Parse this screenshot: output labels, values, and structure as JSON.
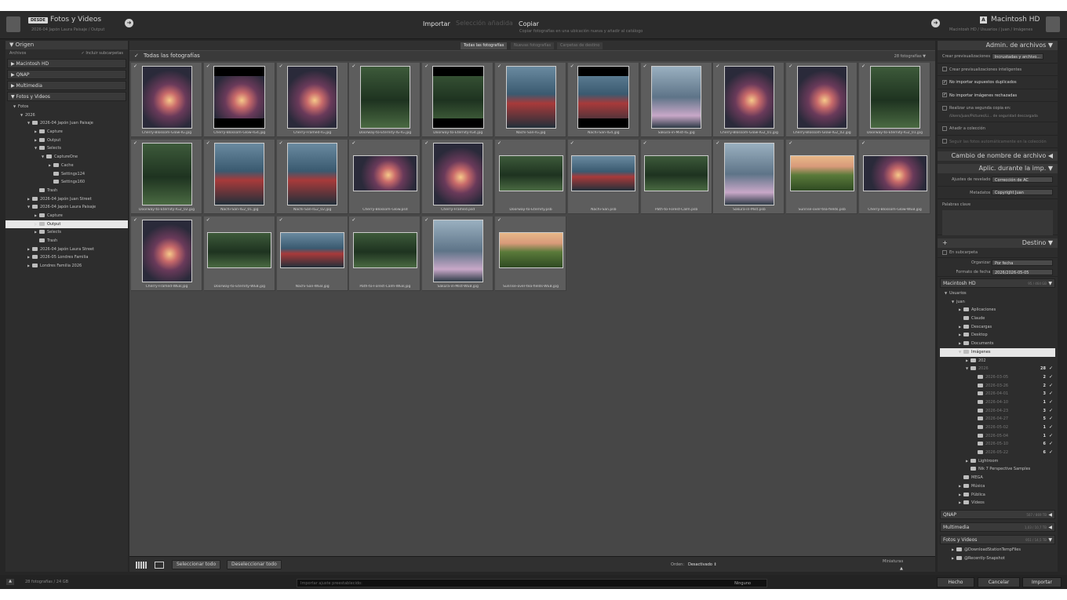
{
  "source": {
    "badge": "DESDE",
    "title": "Fotos y Videos",
    "path": "2026-04 Japón Laura Paisaje / Output",
    "tree": [
      {
        "label": "Fotos",
        "depth": 0,
        "tri": "▼",
        "folder": false
      },
      {
        "label": "2026",
        "depth": 1,
        "tri": "▼",
        "folder": false
      },
      {
        "label": "2026-04 Japón Juan Paisaje",
        "depth": 2,
        "tri": "▼",
        "folder": true
      },
      {
        "label": "Capture",
        "depth": 3,
        "tri": "▶",
        "folder": true
      },
      {
        "label": "Output",
        "depth": 3,
        "tri": "▶",
        "folder": true
      },
      {
        "label": "Selects",
        "depth": 3,
        "tri": "▼",
        "folder": true
      },
      {
        "label": "CaptureOne",
        "depth": 4,
        "tri": "▼",
        "folder": true
      },
      {
        "label": "Cache",
        "depth": 5,
        "tri": "▶",
        "folder": true
      },
      {
        "label": "Settings124",
        "depth": 5,
        "tri": "",
        "folder": true
      },
      {
        "label": "Settings160",
        "depth": 5,
        "tri": "",
        "folder": true
      },
      {
        "label": "Trash",
        "depth": 3,
        "tri": "",
        "folder": true
      },
      {
        "label": "2026-04 Japón Juan Street",
        "depth": 2,
        "tri": "▶",
        "folder": true
      },
      {
        "label": "2026-04 Japón Laura Paisaje",
        "depth": 2,
        "tri": "▼",
        "folder": true
      },
      {
        "label": "Capture",
        "depth": 3,
        "tri": "▶",
        "folder": true
      },
      {
        "label": "Output",
        "depth": 3,
        "tri": "▷",
        "folder": true,
        "selected": true
      },
      {
        "label": "Selects",
        "depth": 3,
        "tri": "▶",
        "folder": true
      },
      {
        "label": "Trash",
        "depth": 3,
        "tri": "",
        "folder": true
      },
      {
        "label": "2026-04 Japón Laura Street",
        "depth": 2,
        "tri": "▶",
        "folder": true
      },
      {
        "label": "2026-05 Londres Familia",
        "depth": 2,
        "tri": "▶",
        "folder": true
      },
      {
        "label": "Londres Familia 2026",
        "depth": 2,
        "tri": "▶",
        "folder": true
      }
    ]
  },
  "left_panel": {
    "header": "Origen",
    "archivos_label": "Archivos",
    "include_sub": "Incluir subcarpetas",
    "volumes": [
      "Macintosh HD",
      "QNAP",
      "Multimedia",
      "Fotos y Videos"
    ],
    "volume_tris": [
      "▶",
      "▶",
      "▶",
      "▼"
    ]
  },
  "modes": {
    "import": "Importar",
    "selection": "Selección añadida",
    "copy": "Copiar",
    "copy_desc": "Copiar fotografías en una ubicación nueva y añadir al catálogo"
  },
  "destination": {
    "badge": "A",
    "title": "Macintosh HD",
    "path": "Macintosh HD / Usuarios / juan / Imágenes"
  },
  "tabs": [
    "Todas las fotografías",
    "Nuevas fotografías",
    "Carpetas de destino"
  ],
  "grid": {
    "title": "Todas las fotografías",
    "count": "28 fotografías",
    "photos": [
      {
        "name": "Cherry-Blossom-Glow-IG.jpg",
        "t": "cherry",
        "o": "p"
      },
      {
        "name": "Cherry-Blossom-Glow-IG4.jpg",
        "t": "cherry",
        "o": "sq"
      },
      {
        "name": "Cherry-Framed-IG.jpg",
        "t": "cherry",
        "o": "p"
      },
      {
        "name": "Doorway-to-Eternity-IG-IG.jpg",
        "t": "forest",
        "o": "p"
      },
      {
        "name": "Doorway-to-Eternity-IG4.jpg",
        "t": "forest",
        "o": "sq"
      },
      {
        "name": "Nachi-San-IG.jpg",
        "t": "pagoda",
        "o": "p"
      },
      {
        "name": "Nachi-San-IG4.jpg",
        "t": "pagoda",
        "o": "sq"
      },
      {
        "name": "Sakura-in-Mist-IG.jpg",
        "t": "mist",
        "o": "p"
      },
      {
        "name": "Cherry-Blossom-Glow-IG2_01.jpg",
        "t": "cherry",
        "o": "p"
      },
      {
        "name": "Cherry-Blossom-Glow-IG2_02.jpg",
        "t": "cherry",
        "o": "p"
      },
      {
        "name": "Doorway-to-Eternity-IG2_01.jpg",
        "t": "forest",
        "o": "p"
      },
      {
        "name": "Doorway-to-Eternity-IG2_02.jpg",
        "t": "forest",
        "o": "p"
      },
      {
        "name": "Nachi-San-IG2_01.jpg",
        "t": "pagoda",
        "o": "p"
      },
      {
        "name": "Nachi-San-IG2_02.jpg",
        "t": "pagoda",
        "o": "p"
      },
      {
        "name": "Cherry-Blossom-Glow.psd",
        "t": "cherry",
        "o": "l"
      },
      {
        "name": "Cherry-Framed.psd",
        "t": "cherry",
        "o": "p"
      },
      {
        "name": "Doorway-to-Eternity.psb",
        "t": "forest",
        "o": "l"
      },
      {
        "name": "Nachi-San.psb",
        "t": "pagoda",
        "o": "l"
      },
      {
        "name": "Path-to-Forest-Calm.psb",
        "t": "forest",
        "o": "l"
      },
      {
        "name": "Sakura-in-Mist.psb",
        "t": "mist",
        "o": "p"
      },
      {
        "name": "Sunrise-over-tea-fields.psb",
        "t": "tea",
        "o": "l"
      },
      {
        "name": "Cherry-Blossom-Glow-WEB.jpg",
        "t": "cherry",
        "o": "l"
      },
      {
        "name": "Cherry-Framed-WEB.jpg",
        "t": "cherry",
        "o": "p"
      },
      {
        "name": "Doorway-to-Eternity-WEB.jpg",
        "t": "forest",
        "o": "l"
      },
      {
        "name": "Nachi-San-WEB.jpg",
        "t": "pagoda",
        "o": "l"
      },
      {
        "name": "Path-to-Forest-Calm-WEB.jpg",
        "t": "forest",
        "o": "l"
      },
      {
        "name": "Sakura-in-Mist-WEB.jpg",
        "t": "mist",
        "o": "p"
      },
      {
        "name": "Sunrise-over-tea-fields-WEB.jpg",
        "t": "tea",
        "o": "l"
      }
    ]
  },
  "bottom": {
    "select_all": "Seleccionar todo",
    "deselect_all": "Deseleccionar todo",
    "sort_label": "Orden:",
    "sort_value": "Desactivado",
    "thumbs_label": "Miniaturas"
  },
  "right_panel": {
    "file_mgmt_header": "Admin. de archivos",
    "build_previews_label": "Crear previsualizaciones",
    "build_previews_value": "Incrustadas y archivo...",
    "smart_previews": "Crear previsualizaciones inteligentes",
    "no_dupes": "No importar supuestos duplicados",
    "no_rejected": "No importar imágenes rechazadas",
    "second_copy": "Realizar una segunda copia en:",
    "second_copy_path": "/Users/juan/Pictures/Li... de seguridad descargada",
    "add_collection": "Añadir a colección",
    "auto_advance": "Seguir las fotos automáticamente en la colección",
    "rename_header": "Cambio de nombre de archivo",
    "apply_header": "Aplic. durante la imp.",
    "dev_label": "Ajustes de revelado",
    "dev_value": "Corrección de AC",
    "meta_label": "Metadatos",
    "meta_value": "Copyright Juan",
    "keywords_label": "Palabras clave",
    "dest_header": "Destino",
    "subfolder": "En subcarpeta",
    "organize_label": "Organizar",
    "organize_value": "Por fecha",
    "date_format_label": "Formato de fecha",
    "date_format_value": "2026/2026-05-05",
    "vol_mac": "Macintosh HD",
    "vol_mac_info": "95 / 464 GB",
    "vol_qnap": "QNAP",
    "vol_qnap_info": "507 / 869 TB",
    "vol_multi": "Multimedia",
    "vol_multi_info": "1,03 / 10,7 TB",
    "vol_fyv": "Fotos y Videos",
    "vol_fyv_info": "951 / 14,5 TB",
    "dtree": [
      {
        "label": "Usuarios",
        "depth": 0,
        "tri": "▼",
        "folder": false
      },
      {
        "label": "juan",
        "depth": 1,
        "tri": "▼",
        "folder": false
      },
      {
        "label": "Aplicaciones",
        "depth": 2,
        "tri": "▶",
        "folder": true
      },
      {
        "label": "Claude",
        "depth": 2,
        "tri": "",
        "folder": true
      },
      {
        "label": "Descargas",
        "depth": 2,
        "tri": "▶",
        "folder": true
      },
      {
        "label": "Desktop",
        "depth": 2,
        "tri": "▶",
        "folder": true
      },
      {
        "label": "Documents",
        "depth": 2,
        "tri": "▶",
        "folder": true
      },
      {
        "label": "Imágenes",
        "depth": 2,
        "tri": "▼",
        "folder": true,
        "selected": true
      },
      {
        "label": "202",
        "depth": 3,
        "tri": "▶",
        "folder": true
      },
      {
        "label": "2026",
        "depth": 3,
        "tri": "▼",
        "folder": true,
        "dim": true,
        "count": "28",
        "check": "✓"
      },
      {
        "label": "2026-03-05",
        "depth": 4,
        "tri": "",
        "folder": true,
        "dim": true,
        "count": "2",
        "check": "✓"
      },
      {
        "label": "2026-03-26",
        "depth": 4,
        "tri": "",
        "folder": true,
        "dim": true,
        "count": "2",
        "check": "✓"
      },
      {
        "label": "2026-04-01",
        "depth": 4,
        "tri": "",
        "folder": true,
        "dim": true,
        "count": "3",
        "check": "✓"
      },
      {
        "label": "2026-04-10",
        "depth": 4,
        "tri": "",
        "folder": true,
        "dim": true,
        "count": "1",
        "check": "✓"
      },
      {
        "label": "2026-04-23",
        "depth": 4,
        "tri": "",
        "folder": true,
        "dim": true,
        "count": "3",
        "check": "✓"
      },
      {
        "label": "2026-04-27",
        "depth": 4,
        "tri": "",
        "folder": true,
        "dim": true,
        "count": "5",
        "check": "✓"
      },
      {
        "label": "2026-05-02",
        "depth": 4,
        "tri": "",
        "folder": true,
        "dim": true,
        "count": "1",
        "check": "✓"
      },
      {
        "label": "2026-05-04",
        "depth": 4,
        "tri": "",
        "folder": true,
        "dim": true,
        "count": "1",
        "check": "✓"
      },
      {
        "label": "2026-05-10",
        "depth": 4,
        "tri": "",
        "folder": true,
        "dim": true,
        "count": "6",
        "check": "✓"
      },
      {
        "label": "2026-05-22",
        "depth": 4,
        "tri": "",
        "folder": true,
        "dim": true,
        "count": "6",
        "check": "✓"
      },
      {
        "label": "Lightroom",
        "depth": 3,
        "tri": "▶",
        "folder": true
      },
      {
        "label": "Nik 7 Perspective Samples",
        "depth": 3,
        "tri": "",
        "folder": true
      },
      {
        "label": "MEGA",
        "depth": 2,
        "tri": "",
        "folder": true
      },
      {
        "label": "Música",
        "depth": 2,
        "tri": "▶",
        "folder": true
      },
      {
        "label": "Pública",
        "depth": 2,
        "tri": "▶",
        "folder": true
      },
      {
        "label": "Vídeos",
        "depth": 2,
        "tri": "▶",
        "folder": true
      }
    ],
    "fyv_tree": [
      "@DownloadStationTempFiles",
      "@Recently-Snapshot"
    ]
  },
  "status": {
    "count": "28 fotografías / 24 GB",
    "preset_label": "Importar ajuste preestablecido:",
    "preset_value": "Ninguno",
    "done": "Hecho",
    "cancel": "Cancelar",
    "import": "Importar"
  }
}
